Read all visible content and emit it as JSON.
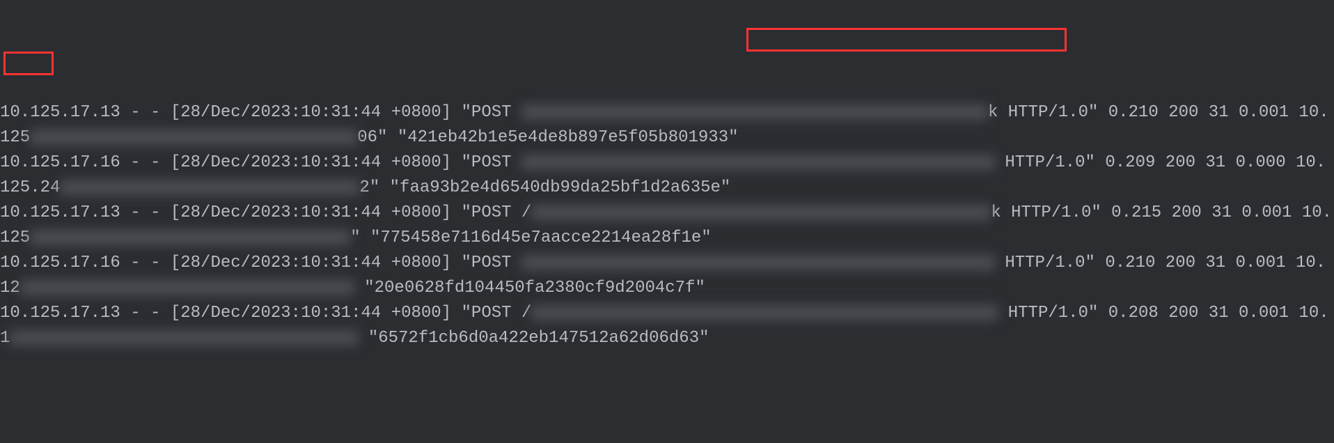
{
  "logs": [
    {
      "ip": "10.125.17.13",
      "timestamp": "[28/Dec/2023:10:31:44 +0800]",
      "method": "\"POST ",
      "redacted1_width": 670,
      "tail1": "k",
      "protocol": " HTTP/1.0\"",
      "timing": " 0.210 200 31 0.001 10.125",
      "redacted2_width": 470,
      "tail2": "06\" ",
      "hash": "\"421eb42b1e5e4de8b897e5f05b801933\""
    },
    {
      "ip": "10.125.17.16",
      "timestamp": "[28/Dec/2023:10:31:44 +0800]",
      "method": "\"POST ",
      "redacted1_width": 680,
      "tail1": "",
      "protocol": " HTTP/1.0\"",
      "timing": " 0.209 200 31 0.000 10.125.24",
      "redacted2_width": 430,
      "tail2": "2\" ",
      "hash": "\"faa93b2e4d6540db99da25bf1d2a635e\""
    },
    {
      "ip": "10.125.17.13",
      "timestamp": "[28/Dec/2023:10:31:44 +0800]",
      "method": "\"POST /",
      "redacted1_width": 660,
      "tail1": "k",
      "protocol": " HTTP/1.0\"",
      "timing": " 0.215 200 31 0.001 10.125",
      "redacted2_width": 460,
      "tail2": "\" ",
      "hash": "\"775458e7116d45e7aacce2214ea28f1e\""
    },
    {
      "ip": "10.125.17.16",
      "timestamp": "[28/Dec/2023:10:31:44 +0800]",
      "method": "\"POST ",
      "redacted1_width": 680,
      "tail1": "",
      "protocol": " HTTP/1.0\"",
      "timing": " 0.210 200 31 0.001 10.12",
      "redacted2_width": 480,
      "tail2": " ",
      "hash": "\"20e0628fd104450fa2380cf9d2004c7f\""
    },
    {
      "ip": "10.125.17.13",
      "timestamp": "[28/Dec/2023:10:31:44 +0800]",
      "method": "\"POST /",
      "redacted1_width": 670,
      "tail1": "",
      "protocol": " HTTP/1.0\"",
      "timing": " 0.208 200 31 0.001 10.1",
      "redacted2_width": 500,
      "tail2": " ",
      "hash": "\"6572f1cb6d0a422eb147512a62d06d63\""
    }
  ]
}
